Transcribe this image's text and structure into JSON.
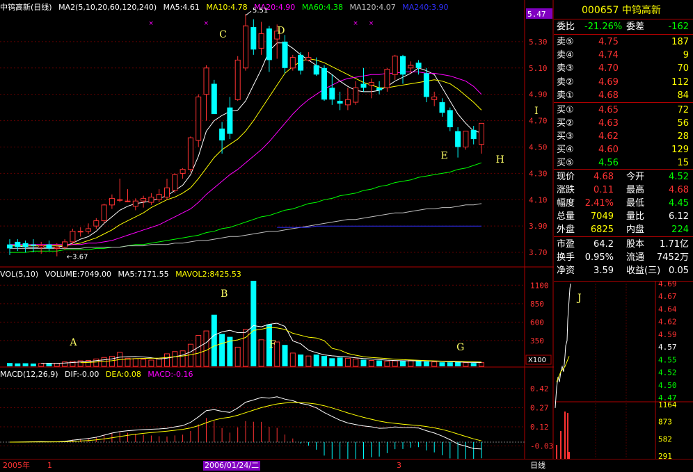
{
  "header": {
    "title": "中钨高新(日线)",
    "ma_label": "MA2(5,10,20,60,120,240)",
    "ma5": "MA5:4.61",
    "ma10": "MA10:4.78",
    "ma20": "MA20:4.90",
    "ma60": "MA60:4.38",
    "ma120": "MA120:4.07",
    "ma240": "MA240:3.90"
  },
  "vol_header": {
    "label": "VOL(5,10)",
    "volume": "VOLUME:7049.00",
    "ma5": "MA5:7171.55",
    "mavol2": "MAVOL2:8425.53"
  },
  "macd_header": {
    "label": "MACD(12,26,9)",
    "dif": "DIF:-0.00",
    "dea": "DEA:0.08",
    "macd": "MACD:-0.16"
  },
  "colors": {
    "up": "#ff3232",
    "down": "#00ffff",
    "ma5": "#ffffff",
    "ma10": "#ffff00",
    "ma20": "#ff00ff",
    "ma60": "#00ff00",
    "ma120": "#c0c0c0",
    "ma240": "#3030ff",
    "axis": "#b00000",
    "annotation": "#ffff66"
  },
  "chart_data": [
    {
      "type": "candlestick",
      "title": "中钨高新(日线)",
      "y_ticks": [
        "5.47",
        "5.30",
        "5.10",
        "4.90",
        "4.70",
        "4.50",
        "4.30",
        "4.10",
        "3.90",
        "3.70"
      ],
      "ylim": [
        3.6,
        5.5
      ],
      "max_label": "5.51",
      "min_label": "3.67",
      "annotations": [
        "C",
        "D",
        "I",
        "E",
        "H"
      ],
      "candles": [
        {
          "o": 3.76,
          "h": 3.8,
          "l": 3.68,
          "c": 3.73
        },
        {
          "o": 3.78,
          "h": 3.8,
          "l": 3.71,
          "c": 3.74
        },
        {
          "o": 3.77,
          "h": 3.79,
          "l": 3.7,
          "c": 3.74
        },
        {
          "o": 3.76,
          "h": 3.8,
          "l": 3.7,
          "c": 3.75
        },
        {
          "o": 3.74,
          "h": 3.78,
          "l": 3.69,
          "c": 3.75
        },
        {
          "o": 3.76,
          "h": 3.79,
          "l": 3.71,
          "c": 3.73
        },
        {
          "o": 3.73,
          "h": 3.77,
          "l": 3.67,
          "c": 3.74
        },
        {
          "o": 3.74,
          "h": 3.8,
          "l": 3.72,
          "c": 3.78
        },
        {
          "o": 3.78,
          "h": 3.88,
          "l": 3.76,
          "c": 3.86
        },
        {
          "o": 3.86,
          "h": 3.89,
          "l": 3.82,
          "c": 3.86
        },
        {
          "o": 3.86,
          "h": 3.92,
          "l": 3.84,
          "c": 3.88
        },
        {
          "o": 3.9,
          "h": 3.96,
          "l": 3.88,
          "c": 3.94
        },
        {
          "o": 3.94,
          "h": 4.07,
          "l": 3.92,
          "c": 4.06
        },
        {
          "o": 4.06,
          "h": 4.14,
          "l": 4.03,
          "c": 4.11
        },
        {
          "o": 4.1,
          "h": 4.26,
          "l": 4.08,
          "c": 4.1
        },
        {
          "o": 4.09,
          "h": 4.18,
          "l": 4.08,
          "c": 4.09
        },
        {
          "o": 4.05,
          "h": 4.11,
          "l": 4.02,
          "c": 4.09
        },
        {
          "o": 4.09,
          "h": 4.13,
          "l": 4.04,
          "c": 4.11
        },
        {
          "o": 4.08,
          "h": 4.15,
          "l": 4.06,
          "c": 4.12
        },
        {
          "o": 4.1,
          "h": 4.18,
          "l": 4.08,
          "c": 4.14
        },
        {
          "o": 4.12,
          "h": 4.26,
          "l": 4.1,
          "c": 4.19
        },
        {
          "o": 4.17,
          "h": 4.3,
          "l": 4.15,
          "c": 4.29
        },
        {
          "o": 4.3,
          "h": 4.34,
          "l": 4.26,
          "c": 4.33
        },
        {
          "o": 4.33,
          "h": 4.58,
          "l": 4.31,
          "c": 4.57
        },
        {
          "o": 4.55,
          "h": 4.9,
          "l": 4.5,
          "c": 4.88
        },
        {
          "o": 4.9,
          "h": 5.12,
          "l": 4.7,
          "c": 5.1
        },
        {
          "o": 4.98,
          "h": 5.01,
          "l": 4.82,
          "c": 4.75
        },
        {
          "o": 4.64,
          "h": 4.69,
          "l": 4.45,
          "c": 4.55
        },
        {
          "o": 4.8,
          "h": 4.88,
          "l": 4.56,
          "c": 4.6
        },
        {
          "o": 4.86,
          "h": 5.19,
          "l": 4.85,
          "c": 5.16
        },
        {
          "o": 5.1,
          "h": 5.51,
          "l": 5.08,
          "c": 5.42
        },
        {
          "o": 5.41,
          "h": 5.47,
          "l": 5.2,
          "c": 5.24
        },
        {
          "o": 5.25,
          "h": 5.45,
          "l": 5.2,
          "c": 5.36
        },
        {
          "o": 5.4,
          "h": 5.42,
          "l": 5.07,
          "c": 5.16
        },
        {
          "o": 5.32,
          "h": 5.43,
          "l": 5.17,
          "c": 5.38
        },
        {
          "o": 5.3,
          "h": 5.35,
          "l": 5.06,
          "c": 5.1
        },
        {
          "o": 5.1,
          "h": 5.2,
          "l": 5.08,
          "c": 5.18
        },
        {
          "o": 5.2,
          "h": 5.22,
          "l": 5.05,
          "c": 5.08
        },
        {
          "o": 5.16,
          "h": 5.22,
          "l": 5.15,
          "c": 5.18
        },
        {
          "o": 5.12,
          "h": 5.18,
          "l": 5.04,
          "c": 5.05
        },
        {
          "o": 5.1,
          "h": 5.12,
          "l": 4.85,
          "c": 4.86
        },
        {
          "o": 4.95,
          "h": 5.05,
          "l": 4.82,
          "c": 4.86
        },
        {
          "o": 4.85,
          "h": 4.92,
          "l": 4.78,
          "c": 4.83
        },
        {
          "o": 4.82,
          "h": 4.95,
          "l": 4.78,
          "c": 4.86
        },
        {
          "o": 4.84,
          "h": 5.0,
          "l": 4.82,
          "c": 4.95
        },
        {
          "o": 4.98,
          "h": 5.1,
          "l": 4.92,
          "c": 4.95
        },
        {
          "o": 4.97,
          "h": 5.02,
          "l": 4.87,
          "c": 4.99
        },
        {
          "o": 4.95,
          "h": 5.0,
          "l": 4.9,
          "c": 4.93
        },
        {
          "o": 4.95,
          "h": 5.1,
          "l": 4.92,
          "c": 5.09
        },
        {
          "o": 5.05,
          "h": 5.2,
          "l": 5.01,
          "c": 5.19
        },
        {
          "o": 5.19,
          "h": 5.2,
          "l": 4.98,
          "c": 5.05
        },
        {
          "o": 5.1,
          "h": 5.15,
          "l": 5.06,
          "c": 5.12
        },
        {
          "o": 5.14,
          "h": 5.16,
          "l": 5.05,
          "c": 5.1
        },
        {
          "o": 5.06,
          "h": 5.1,
          "l": 4.84,
          "c": 4.88
        },
        {
          "o": 4.86,
          "h": 4.92,
          "l": 4.81,
          "c": 4.88
        },
        {
          "o": 4.84,
          "h": 4.87,
          "l": 4.73,
          "c": 4.76
        },
        {
          "o": 4.78,
          "h": 4.8,
          "l": 4.62,
          "c": 4.65
        },
        {
          "o": 4.62,
          "h": 4.65,
          "l": 4.42,
          "c": 4.5
        },
        {
          "o": 4.5,
          "h": 4.62,
          "l": 4.48,
          "c": 4.62
        },
        {
          "o": 4.63,
          "h": 4.66,
          "l": 4.52,
          "c": 4.56
        },
        {
          "o": 4.52,
          "h": 4.68,
          "l": 4.45,
          "c": 4.68
        }
      ],
      "ma_lines": [
        {
          "name": "MA5",
          "color": "#ffffff",
          "values": [
            3.75,
            3.75,
            3.74,
            3.74,
            3.74,
            3.74,
            3.74,
            3.75,
            3.77,
            3.8,
            3.82,
            3.86,
            3.92,
            3.97,
            4.02,
            4.05,
            4.07,
            4.08,
            4.09,
            4.11,
            4.13,
            4.17,
            4.21,
            4.29,
            4.43,
            4.62,
            4.7,
            4.74,
            4.77,
            4.78,
            4.85,
            4.97,
            5.09,
            5.23,
            5.29,
            5.29,
            5.25,
            5.2,
            5.16,
            5.12,
            5.09,
            5.05,
            5.0,
            4.96,
            4.93,
            4.92,
            4.92,
            4.93,
            4.96,
            5.0,
            5.03,
            5.06,
            5.1,
            5.08,
            5.05,
            4.95,
            4.85,
            4.75,
            4.68,
            4.62,
            4.61
          ]
        },
        {
          "name": "MA10",
          "color": "#ffff00",
          "values": [
            3.75,
            3.75,
            3.75,
            3.75,
            3.75,
            3.75,
            3.75,
            3.75,
            3.76,
            3.77,
            3.79,
            3.81,
            3.84,
            3.87,
            3.91,
            3.94,
            3.97,
            4.0,
            4.04,
            4.07,
            4.1,
            4.12,
            4.15,
            4.19,
            4.26,
            4.34,
            4.42,
            4.48,
            4.52,
            4.56,
            4.62,
            4.7,
            4.79,
            4.88,
            4.97,
            5.06,
            5.11,
            5.15,
            5.17,
            5.16,
            5.14,
            5.11,
            5.08,
            5.05,
            5.02,
            4.99,
            4.97,
            4.95,
            4.95,
            4.96,
            4.97,
            4.98,
            4.99,
            5.0,
            5.01,
            5.0,
            4.98,
            4.94,
            4.89,
            4.84,
            4.78
          ]
        },
        {
          "name": "MA20",
          "color": "#ff00ff",
          "values": [
            3.76,
            3.76,
            3.76,
            3.76,
            3.76,
            3.76,
            3.76,
            3.76,
            3.76,
            3.76,
            3.77,
            3.77,
            3.78,
            3.79,
            3.81,
            3.83,
            3.85,
            3.87,
            3.89,
            3.91,
            3.94,
            3.97,
            4.0,
            4.03,
            4.08,
            4.14,
            4.19,
            4.24,
            4.29,
            4.33,
            4.38,
            4.43,
            4.48,
            4.54,
            4.61,
            4.68,
            4.75,
            4.81,
            4.86,
            4.9,
            4.94,
            4.97,
            5.0,
            5.02,
            5.03,
            5.04,
            5.05,
            5.05,
            5.06,
            5.06,
            5.07,
            5.07,
            5.07,
            5.06,
            5.06,
            5.05,
            5.04,
            5.02,
            5.0,
            4.96,
            4.9
          ]
        },
        {
          "name": "MA60",
          "color": "#00ff00",
          "values": [
            3.7,
            3.7,
            3.7,
            3.71,
            3.71,
            3.71,
            3.71,
            3.72,
            3.72,
            3.72,
            3.72,
            3.73,
            3.73,
            3.74,
            3.74,
            3.75,
            3.76,
            3.76,
            3.77,
            3.78,
            3.79,
            3.8,
            3.81,
            3.82,
            3.83,
            3.85,
            3.86,
            3.88,
            3.89,
            3.91,
            3.93,
            3.95,
            3.97,
            3.98,
            4.0,
            4.02,
            4.03,
            4.05,
            4.07,
            4.08,
            4.1,
            4.11,
            4.13,
            4.14,
            4.15,
            4.17,
            4.18,
            4.2,
            4.21,
            4.23,
            4.24,
            4.25,
            4.27,
            4.28,
            4.29,
            4.3,
            4.31,
            4.33,
            4.34,
            4.36,
            4.38
          ]
        },
        {
          "name": "MA120",
          "color": "#c0c0c0",
          "values": [
            3.73,
            3.73,
            3.73,
            3.73,
            3.73,
            3.73,
            3.73,
            3.73,
            3.73,
            3.73,
            3.74,
            3.74,
            3.74,
            3.74,
            3.74,
            3.75,
            3.75,
            3.75,
            3.76,
            3.76,
            3.76,
            3.77,
            3.77,
            3.78,
            3.79,
            3.79,
            3.8,
            3.81,
            3.82,
            3.82,
            3.83,
            3.84,
            3.85,
            3.86,
            3.86,
            3.87,
            3.88,
            3.89,
            3.9,
            3.91,
            3.92,
            3.93,
            3.94,
            3.95,
            3.95,
            3.96,
            3.97,
            3.98,
            3.99,
            4.0,
            4.0,
            4.01,
            4.02,
            4.03,
            4.03,
            4.04,
            4.04,
            4.05,
            4.06,
            4.06,
            4.07
          ]
        },
        {
          "name": "MA240",
          "color": "#3030ff",
          "values": [
            null,
            null,
            null,
            null,
            null,
            null,
            null,
            null,
            null,
            null,
            null,
            null,
            null,
            null,
            null,
            null,
            null,
            null,
            null,
            null,
            null,
            null,
            null,
            null,
            null,
            null,
            null,
            null,
            null,
            null,
            null,
            null,
            null,
            null,
            3.89,
            3.89,
            3.89,
            3.89,
            3.89,
            3.9,
            3.9,
            3.9,
            3.9,
            3.9,
            3.9,
            3.9,
            3.9,
            3.9,
            3.9,
            3.9,
            3.9,
            3.9,
            3.9,
            3.9,
            3.9,
            3.9,
            3.9,
            3.9,
            3.9,
            3.9,
            3.9
          ]
        }
      ]
    },
    {
      "type": "bar",
      "title": "VOL(5,10)",
      "y_ticks": [
        "1100",
        "850",
        "600",
        "350"
      ],
      "unit": "X100",
      "annotations": [
        "A",
        "B",
        "F",
        "G"
      ],
      "ylim": [
        0,
        1150
      ],
      "values": [
        45,
        40,
        42,
        38,
        40,
        45,
        42,
        60,
        70,
        75,
        80,
        100,
        120,
        135,
        190,
        110,
        105,
        95,
        85,
        100,
        170,
        200,
        210,
        300,
        420,
        480,
        700,
        440,
        400,
        260,
        500,
        1160,
        360,
        570,
        330,
        290,
        180,
        160,
        140,
        160,
        140,
        110,
        120,
        110,
        100,
        90,
        80,
        80,
        70,
        75,
        70,
        80,
        75,
        65,
        60,
        55,
        55,
        60,
        50,
        45,
        50
      ]
    },
    {
      "type": "bar",
      "title": "MACD(12,26,9)",
      "y_ticks": [
        "0.42",
        "0.27",
        "0.12",
        "-0.03"
      ],
      "ylim": [
        -0.12,
        0.48
      ]
    }
  ],
  "right_panel": {
    "code_name": "000657 中钨高新",
    "wei_bi_label": "委比",
    "wei_bi": "-21.26%",
    "wei_cha_label": "委差",
    "wei_cha": "-162",
    "sell": [
      {
        "label": "卖⑤",
        "price": "4.75",
        "vol": "187"
      },
      {
        "label": "卖④",
        "price": "4.74",
        "vol": "9"
      },
      {
        "label": "卖③",
        "price": "4.70",
        "vol": "70"
      },
      {
        "label": "卖②",
        "price": "4.69",
        "vol": "112"
      },
      {
        "label": "卖①",
        "price": "4.68",
        "vol": "84"
      }
    ],
    "buy": [
      {
        "label": "买①",
        "price": "4.65",
        "vol": "72"
      },
      {
        "label": "买②",
        "price": "4.63",
        "vol": "56"
      },
      {
        "label": "买③",
        "price": "4.62",
        "vol": "28"
      },
      {
        "label": "买④",
        "price": "4.60",
        "vol": "129"
      },
      {
        "label": "买⑤",
        "price": "4.56",
        "vol": "15"
      }
    ],
    "quote": [
      {
        "l1": "现价",
        "v1": "4.68",
        "l2": "今开",
        "v2": "4.52"
      },
      {
        "l1": "涨跌",
        "v1": "0.11",
        "l2": "最高",
        "v2": "4.68"
      },
      {
        "l1": "幅度",
        "v1": "2.41%",
        "l2": "最低",
        "v2": "4.45"
      },
      {
        "l1": "总量",
        "v1": "7049",
        "l2": "量比",
        "v2": "6.12"
      },
      {
        "l1": "外盘",
        "v1": "6825",
        "l2": "内盘",
        "v2": "224"
      }
    ],
    "fund": [
      {
        "l1": "市盈",
        "v1": "64.2",
        "l2": "股本",
        "v2": "1.71亿"
      },
      {
        "l1": "换手",
        "v1": "0.95%",
        "l2": "流通",
        "v2": "7452万"
      },
      {
        "l1": "净资",
        "v1": "3.59",
        "l2": "收益(三)",
        "v2": "0.05"
      }
    ],
    "intraday_price_ticks": [
      "4.69",
      "4.67",
      "4.64",
      "4.62",
      "4.59",
      "4.57",
      "4.55",
      "4.52",
      "4.50",
      "4.47"
    ],
    "intraday_vol_ticks": [
      "1164",
      "873",
      "582",
      "291"
    ],
    "intraday_annotation": "J"
  },
  "bottom_tabs": {
    "year": "2005年",
    "t1": "1",
    "date": "2006/01/24/二",
    "t3": "3",
    "daily": "日线"
  }
}
